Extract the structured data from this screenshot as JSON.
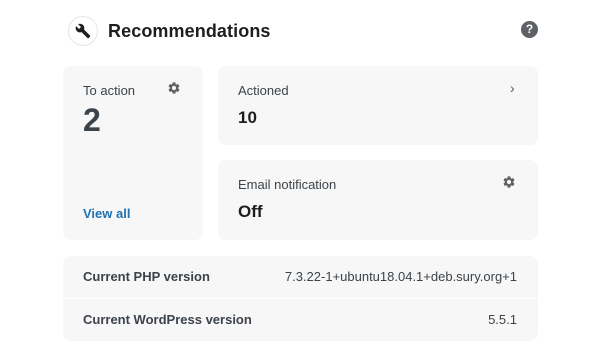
{
  "header": {
    "title": "Recommendations",
    "icon": "wrench-icon",
    "help_icon": "question-icon",
    "help_symbol": "?"
  },
  "to_action": {
    "label": "To action",
    "count": "2",
    "link": "View all",
    "icon": "gear-icon"
  },
  "actioned": {
    "label": "Actioned",
    "count": "10",
    "chevron": "›",
    "icon": "chevron-right-icon"
  },
  "email_notification": {
    "label": "Email notification",
    "value": "Off",
    "icon": "gear-icon"
  },
  "versions": [
    {
      "label": "Current PHP version",
      "value": "7.3.22-1+ubuntu18.04.1+deb.sury.org+1"
    },
    {
      "label": "Current WordPress version",
      "value": "5.5.1"
    }
  ],
  "colors": {
    "card_bg": "#f7f7f7",
    "link": "#2271b1",
    "text": "#3c434a",
    "icon": "#5e6165"
  }
}
